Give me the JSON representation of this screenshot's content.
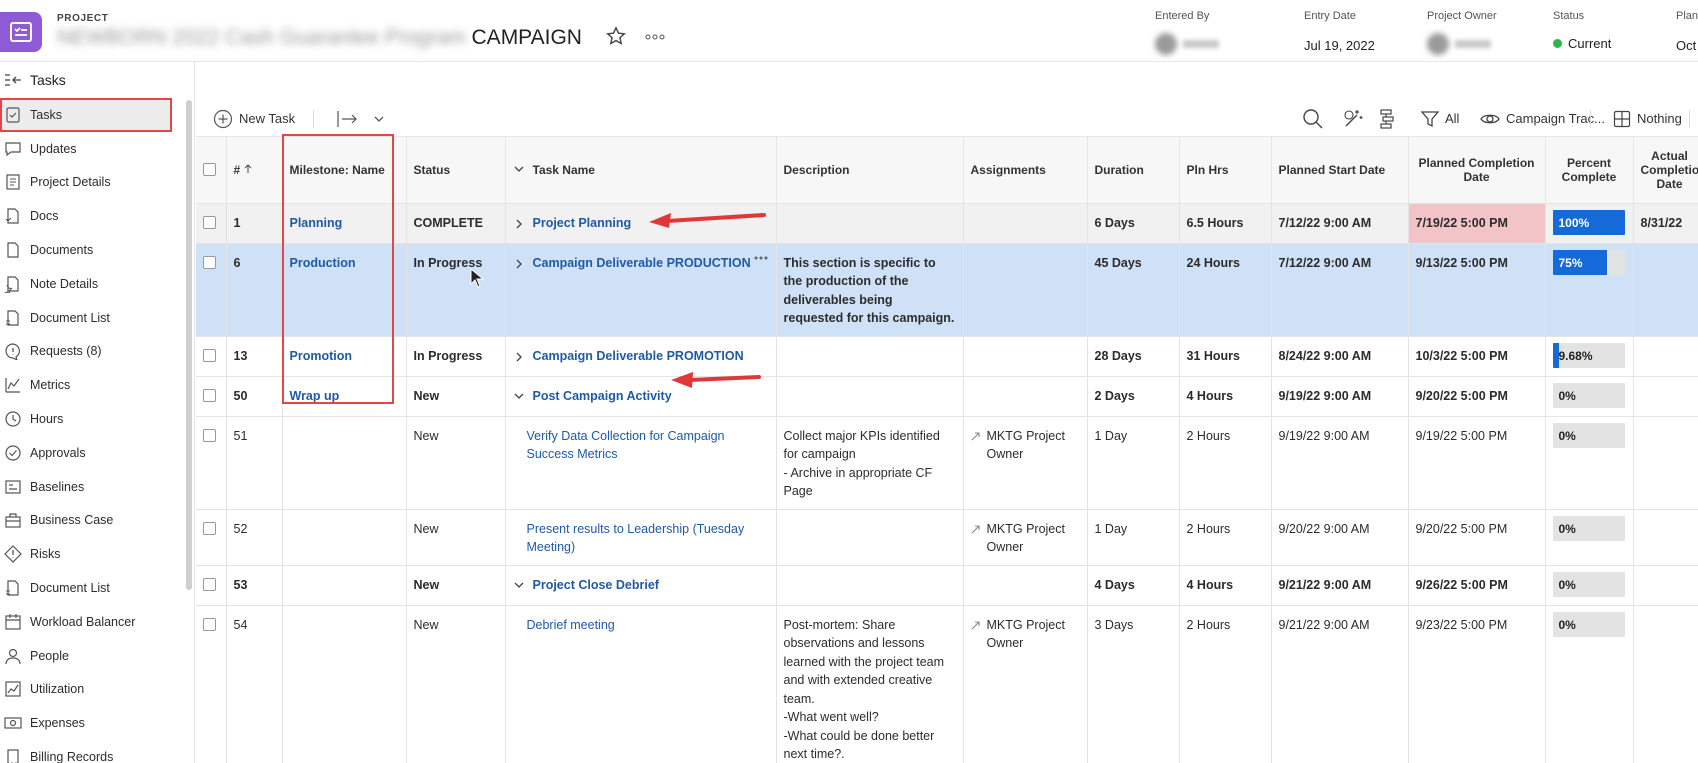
{
  "header": {
    "kicker": "PROJECT",
    "title_blurred": "NEWBORN 2022 Cash Guarantee Program",
    "title_visible": "CAMPAIGN",
    "fields": [
      {
        "label": "Entered By",
        "value": ""
      },
      {
        "label": "Entry Date",
        "value": "Jul 19, 2022"
      },
      {
        "label": "Project Owner",
        "value": ""
      },
      {
        "label": "Status",
        "value": "Current"
      },
      {
        "label": "Plann",
        "value": "Oct"
      }
    ],
    "status_color": "#2db84d",
    "brand_color": "#8e5ad6"
  },
  "sidebar": {
    "title": "Tasks",
    "items": [
      {
        "label": "Tasks",
        "icon": "tasks-icon"
      },
      {
        "label": "Updates",
        "icon": "updates-icon"
      },
      {
        "label": "Project Details",
        "icon": "details-icon"
      },
      {
        "label": "Docs",
        "icon": "docs-icon"
      },
      {
        "label": "Documents",
        "icon": "document-icon"
      },
      {
        "label": "Note Details",
        "icon": "note-icon"
      },
      {
        "label": "Document List",
        "icon": "doc-list-icon"
      },
      {
        "label": "Requests (8)",
        "icon": "requests-icon"
      },
      {
        "label": "Metrics",
        "icon": "metrics-icon"
      },
      {
        "label": "Hours",
        "icon": "clock-icon"
      },
      {
        "label": "Approvals",
        "icon": "approval-icon"
      },
      {
        "label": "Baselines",
        "icon": "baseline-icon"
      },
      {
        "label": "Business Case",
        "icon": "business-case-icon"
      },
      {
        "label": "Risks",
        "icon": "risk-icon"
      },
      {
        "label": "Document List",
        "icon": "doc-list-icon"
      },
      {
        "label": "Workload Balancer",
        "icon": "calendar-icon"
      },
      {
        "label": "People",
        "icon": "people-icon"
      },
      {
        "label": "Utilization",
        "icon": "utilization-icon"
      },
      {
        "label": "Expenses",
        "icon": "expenses-icon"
      },
      {
        "label": "Billing Records",
        "icon": "billing-icon"
      }
    ]
  },
  "toolbar": {
    "new_task": "New Task",
    "filter": "All",
    "view": "Campaign Trac...",
    "grouping": "Nothing"
  },
  "grid": {
    "columns": [
      "#",
      "Milestone: Name",
      "Status",
      "Task Name",
      "Description",
      "Assignments",
      "Duration",
      "Pln Hrs",
      "Planned Start Date",
      "Planned Completion Date",
      "Percent Complete",
      "Actual Completion Date"
    ],
    "rows": [
      {
        "num": "1",
        "milestone": "Planning",
        "status": "COMPLETE",
        "task": "Project Planning",
        "desc": "",
        "assign": "",
        "duration": "6 Days",
        "hrs": "6.5 Hours",
        "start": "7/12/22 9:00 AM",
        "end": "7/19/22 5:00 PM",
        "pct": 100,
        "pct_label": "100%",
        "actual": "8/31/22",
        "bold": true,
        "expand": "right",
        "indent": false
      },
      {
        "num": "6",
        "milestone": "Production",
        "status": "In Progress",
        "task": "Campaign Deliverable PRODUCTION",
        "desc": "This section is specific to the production of the deliverables being requested for this campaign.",
        "assign": "",
        "duration": "45 Days",
        "hrs": "24 Hours",
        "start": "7/12/22 9:00 AM",
        "end": "9/13/22 5:00 PM",
        "pct": 75,
        "pct_label": "75%",
        "actual": "",
        "bold": true,
        "expand": "right",
        "indent": false
      },
      {
        "num": "13",
        "milestone": "Promotion",
        "status": "In Progress",
        "task": "Campaign Deliverable PROMOTION",
        "desc": "",
        "assign": "",
        "duration": "28 Days",
        "hrs": "31 Hours",
        "start": "8/24/22 9:00 AM",
        "end": "10/3/22 5:00 PM",
        "pct": 9.68,
        "pct_label": "9.68%",
        "actual": "",
        "bold": true,
        "expand": "right",
        "indent": false
      },
      {
        "num": "50",
        "milestone": "Wrap up",
        "status": "New",
        "task": "Post Campaign Activity",
        "desc": "",
        "assign": "",
        "duration": "2 Days",
        "hrs": "4 Hours",
        "start": "9/19/22 9:00 AM",
        "end": "9/20/22 5:00 PM",
        "pct": 0,
        "pct_label": "0%",
        "actual": "",
        "bold": true,
        "expand": "down",
        "indent": false
      },
      {
        "num": "51",
        "milestone": "",
        "status": "New",
        "task": "Verify Data Collection for Campaign Success Metrics",
        "desc": "Collect major KPIs identified for campaign\n- Archive in appropriate CF Page",
        "assign": "MKTG Project Owner",
        "duration": "1 Day",
        "hrs": "2 Hours",
        "start": "9/19/22 9:00 AM",
        "end": "9/19/22 5:00 PM",
        "pct": 0,
        "pct_label": "0%",
        "actual": "",
        "bold": false,
        "expand": "",
        "indent": true
      },
      {
        "num": "52",
        "milestone": "",
        "status": "New",
        "task": "Present results to Leadership (Tuesday Meeting)",
        "desc": "",
        "assign": "MKTG Project Owner",
        "duration": "1 Day",
        "hrs": "2 Hours",
        "start": "9/20/22 9:00 AM",
        "end": "9/20/22 5:00 PM",
        "pct": 0,
        "pct_label": "0%",
        "actual": "",
        "bold": false,
        "expand": "",
        "indent": true
      },
      {
        "num": "53",
        "milestone": "",
        "status": "New",
        "task": "Project Close Debrief",
        "desc": "",
        "assign": "",
        "duration": "4 Days",
        "hrs": "4 Hours",
        "start": "9/21/22 9:00 AM",
        "end": "9/26/22 5:00 PM",
        "pct": 0,
        "pct_label": "0%",
        "actual": "",
        "bold": true,
        "expand": "down",
        "indent": false
      },
      {
        "num": "54",
        "milestone": "",
        "status": "New",
        "task": "Debrief meeting",
        "desc": "Post-mortem: Share observations and lessons learned with the project team and with extended creative team.\n-What went well?\n-What could be done better next time?.\n-Pass out the Kudos",
        "assign": "MKTG Project Owner",
        "duration": "3 Days",
        "hrs": "2 Hours",
        "start": "9/21/22 9:00 AM",
        "end": "9/23/22 5:00 PM",
        "pct": 0,
        "pct_label": "0%",
        "actual": "",
        "bold": false,
        "expand": "",
        "indent": true
      }
    ],
    "accent_color": "#1569d8",
    "late_color": "#f2c4c8",
    "selected_row_color": "#cfe1f7"
  }
}
